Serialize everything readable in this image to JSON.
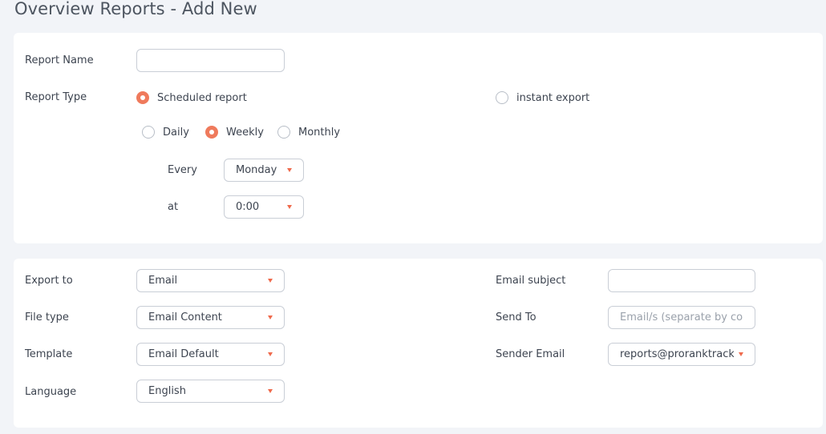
{
  "page": {
    "title": "Overview Reports - Add New"
  },
  "report": {
    "name_label": "Report Name",
    "name_value": "",
    "type_label": "Report Type",
    "type_options": [
      {
        "label": "Scheduled report",
        "selected": true
      },
      {
        "label": "instant export",
        "selected": false
      }
    ],
    "frequency_options": [
      {
        "label": "Daily",
        "selected": false
      },
      {
        "label": "Weekly",
        "selected": true
      },
      {
        "label": "Monthly",
        "selected": false
      }
    ],
    "every_label": "Every",
    "every_value": "Monday",
    "at_label": "at",
    "at_value": "0:00"
  },
  "export": {
    "export_to_label": "Export to",
    "export_to_value": "Email",
    "file_type_label": "File type",
    "file_type_value": "Email Content",
    "template_label": "Template",
    "template_value": "Email Default",
    "language_label": "Language",
    "language_value": "English",
    "subject_label": "Email subject",
    "subject_value": "",
    "send_to_label": "Send To",
    "send_to_placeholder": "Email/s (separate by comma)",
    "sender_label": "Sender Email",
    "sender_value": "reports@proranktracker.com"
  },
  "colors": {
    "accent": "#ef7a5c",
    "background": "#f2f4f8",
    "card": "#ffffff"
  }
}
